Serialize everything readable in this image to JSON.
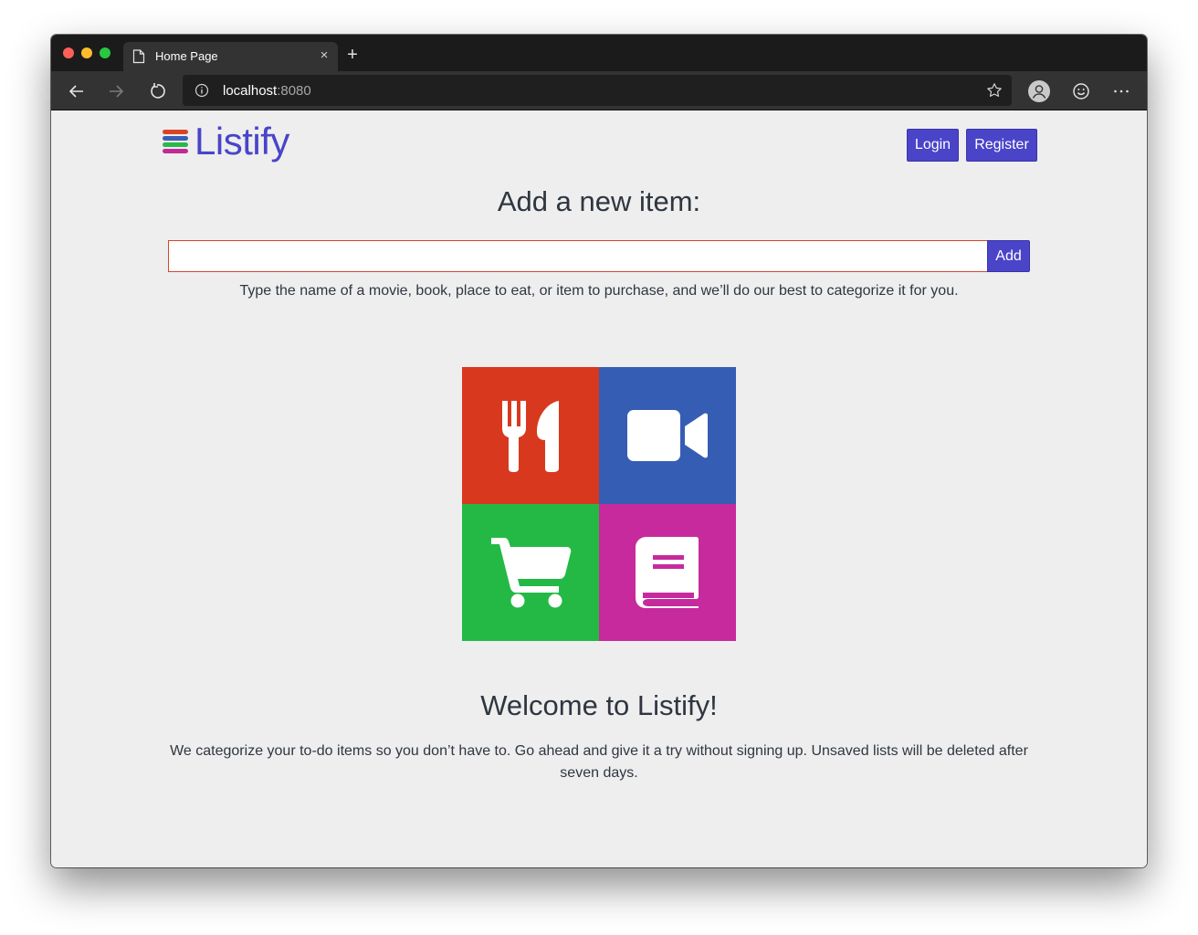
{
  "browser": {
    "tab_title": "Home Page",
    "tab_close": "×",
    "new_tab": "+",
    "address_host": "localhost",
    "address_port": ":8080"
  },
  "header": {
    "logo_text": "Listify",
    "logo_colors": [
      "#d8442a",
      "#3a5fb5",
      "#2ab84a",
      "#c0299a"
    ],
    "login_label": "Login",
    "register_label": "Register"
  },
  "add_item": {
    "heading": "Add a new item:",
    "input_value": "",
    "button_label": "Add",
    "hint": "Type the name of a movie, book, place to eat, or item to purchase, and we’ll do our best to categorize it for you."
  },
  "categories": [
    {
      "name": "food",
      "icon": "utensils-icon",
      "color": "#d8391e"
    },
    {
      "name": "movies",
      "icon": "video-camera-icon",
      "color": "#365db4"
    },
    {
      "name": "shopping",
      "icon": "shopping-cart-icon",
      "color": "#24b945"
    },
    {
      "name": "books",
      "icon": "book-icon",
      "color": "#c72a9d"
    }
  ],
  "welcome": {
    "heading": "Welcome to Listify!",
    "text": "We categorize your to-do items so you don’t have to. Go ahead and give it a try without signing up. Unsaved lists will be deleted after seven days."
  },
  "theme": {
    "accent": "#4a44c9",
    "page_background": "#eeeeee",
    "text": "#2f3640"
  }
}
